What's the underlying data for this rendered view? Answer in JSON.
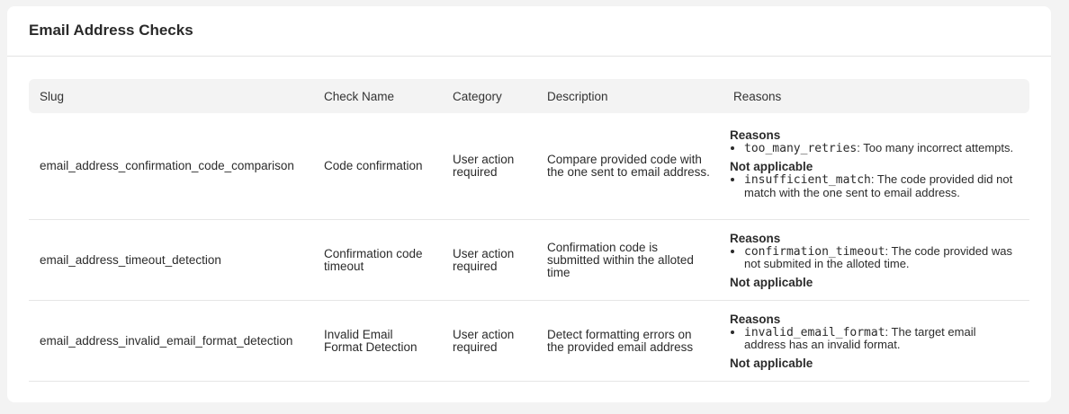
{
  "title": "Email Address Checks",
  "columns": [
    "Slug",
    "Check Name",
    "Category",
    "Description",
    "Reasons"
  ],
  "rows": [
    {
      "slug": "email_address_confirmation_code_comparison",
      "check_name": "Code confirmation",
      "category": "User action required",
      "description": "Compare provided code with the one sent to email address.",
      "reasons_heading": "Reasons",
      "reasons": [
        {
          "code": "too_many_retries",
          "text": ": Too many incorrect attempts."
        }
      ],
      "not_applicable_heading": "Not applicable",
      "not_applicable": [
        {
          "code": "insufficient_match",
          "text": ": The code provided did not match with the one sent to email address."
        }
      ]
    },
    {
      "slug": "email_address_timeout_detection",
      "check_name": "Confirmation code timeout",
      "category": "User action required",
      "description": "Confirmation code is submitted within the alloted time",
      "reasons_heading": "Reasons",
      "reasons": [
        {
          "code": "confirmation_timeout",
          "text": ": The code provided was not submited in the alloted time."
        }
      ],
      "not_applicable_heading": "Not applicable",
      "not_applicable": []
    },
    {
      "slug": "email_address_invalid_email_format_detection",
      "check_name": "Invalid Email Format Detection",
      "category": "User action required",
      "description": "Detect formatting errors on the provided email address",
      "reasons_heading": "Reasons",
      "reasons": [
        {
          "code": "invalid_email_format",
          "text": ": The target email address has an invalid format."
        }
      ],
      "not_applicable_heading": "Not applicable",
      "not_applicable": []
    }
  ]
}
